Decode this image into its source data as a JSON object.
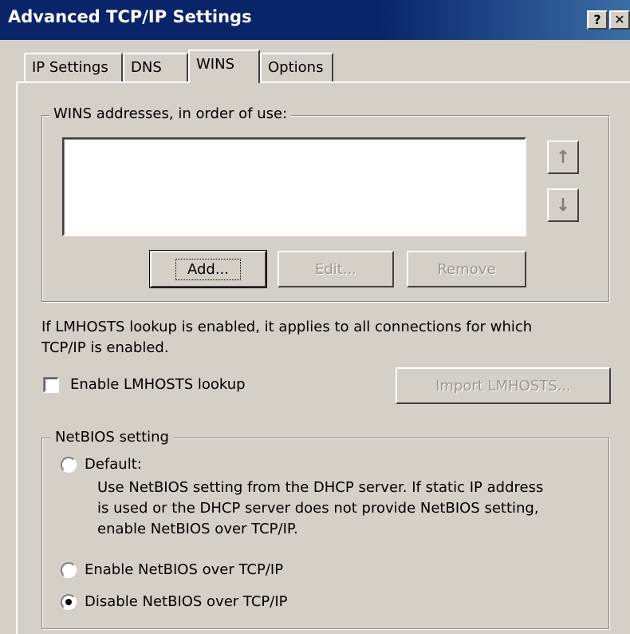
{
  "window": {
    "title": "Advanced TCP/IP Settings",
    "help_glyph": "?",
    "close_glyph": "✕"
  },
  "tabs": [
    {
      "label": "IP Settings",
      "active": false
    },
    {
      "label": "DNS",
      "active": false
    },
    {
      "label": "WINS",
      "active": true
    },
    {
      "label": "Options",
      "active": false
    }
  ],
  "wins": {
    "legend": "WINS addresses, in order of use:",
    "addresses": [],
    "move_up_icon": "up-arrow",
    "move_down_icon": "down-arrow",
    "add_label": "Add...",
    "edit_label": "Edit...",
    "remove_label": "Remove"
  },
  "lmhosts": {
    "info_line1": "If LMHOSTS lookup is enabled, it applies to all connections for which",
    "info_line2": "TCP/IP is enabled.",
    "enable_label": "Enable LMHOSTS lookup",
    "enable_checked": false,
    "import_label": "Import LMHOSTS..."
  },
  "netbios": {
    "legend": "NetBIOS setting",
    "options": [
      {
        "label": "Default:",
        "selected": false
      },
      {
        "label": "Enable NetBIOS over TCP/IP",
        "selected": false
      },
      {
        "label": "Disable NetBIOS over TCP/IP",
        "selected": true
      }
    ],
    "default_desc_line1": "Use NetBIOS setting from the DHCP server. If static IP address",
    "default_desc_line2": "is used or the DHCP server does not provide NetBIOS setting,",
    "default_desc_line3": "enable NetBIOS over TCP/IP."
  },
  "colors": {
    "titlebar": "#0a246a",
    "face": "#d4d0c8",
    "disabled_text": "#9a978f"
  }
}
